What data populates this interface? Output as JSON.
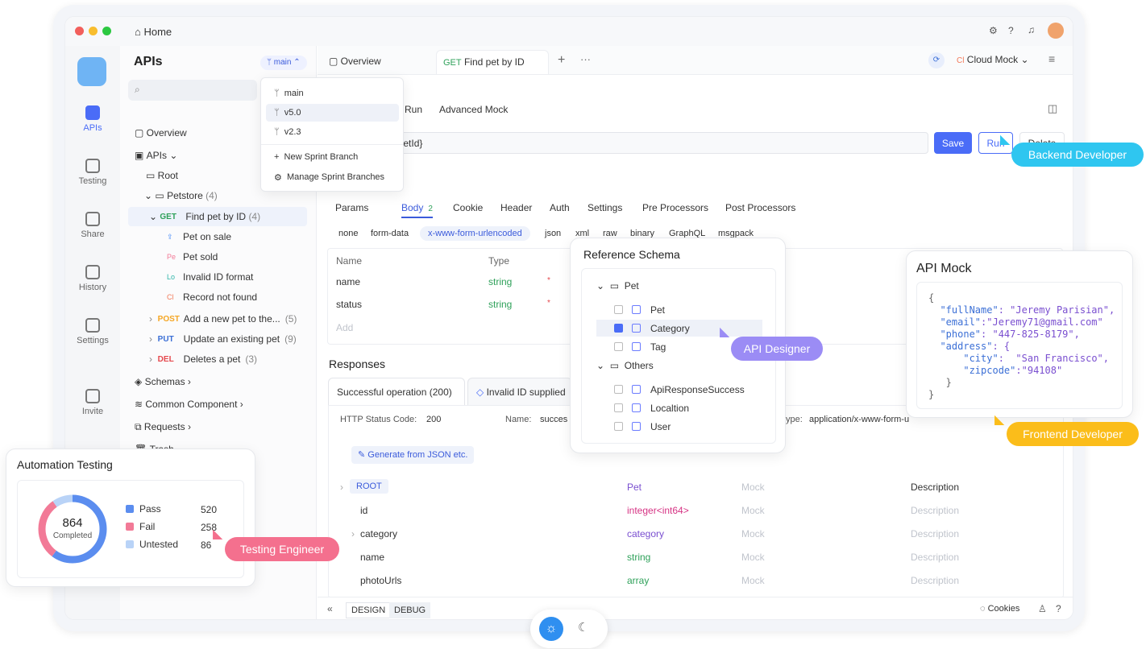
{
  "titlebar": {
    "home": "Home"
  },
  "rail": [
    {
      "label": "APIs",
      "icon": "apis-icon"
    },
    {
      "label": "Testing",
      "icon": "testing-icon"
    },
    {
      "label": "Share",
      "icon": "share-icon"
    },
    {
      "label": "History",
      "icon": "history-icon"
    },
    {
      "label": "Settings",
      "icon": "settings-icon"
    },
    {
      "label": "Invite",
      "icon": "invite-icon"
    }
  ],
  "tree": {
    "title": "APIs",
    "branch": "main",
    "overview": "Overview",
    "apis": "APIs",
    "root": "Root",
    "petstore": "Petstore",
    "petstore_count": "(4)",
    "find_pet": "Find pet by ID",
    "find_count": "(4)",
    "examples": [
      {
        "badge": "⇪",
        "label": "Pet on sale"
      },
      {
        "badge": "Pe",
        "label": "Pet sold"
      },
      {
        "badge": "Lo",
        "label": "Invalid ID format"
      },
      {
        "badge": "Cl",
        "label": "Record not found"
      }
    ],
    "endpoints": [
      {
        "method": "POST",
        "label": "Add a new pet to the...",
        "count": "(5)",
        "color": "#f5a623"
      },
      {
        "method": "PUT",
        "label": "Update an existing pet",
        "count": "(9)",
        "color": "#3b6fd6"
      },
      {
        "method": "DEL",
        "label": "Deletes a pet",
        "count": "(3)",
        "color": "#e5484d"
      }
    ],
    "get": "GET",
    "schemas": "Schemas",
    "common": "Common Component",
    "requests": "Requests",
    "trash": "Trash"
  },
  "branch_menu": {
    "items": [
      "main",
      "v5.0",
      "v2.3"
    ],
    "new": "New Sprint Branch",
    "manage": "Manage Sprint Branches"
  },
  "tabs": {
    "overview": "Overview",
    "active_method": "GET",
    "active": "Find pet by ID",
    "env": "Cloud Mock",
    "env_badge": "Cl"
  },
  "subtabs": {
    "run": "Run",
    "advanced": "Advanced Mock"
  },
  "url": "t/{petId}",
  "buttons": {
    "save": "Save",
    "run": "Run",
    "delete": "Delete"
  },
  "req_tabs": [
    "Params",
    "Body",
    "Cookie",
    "Header",
    "Auth",
    "Settings",
    "Pre Processors",
    "Post Processors"
  ],
  "body_count": "2",
  "body_types": [
    "none",
    "form-data",
    "x-www-form-urlencoded",
    "json",
    "xml",
    "raw",
    "binary",
    "GraphQL",
    "msgpack"
  ],
  "params": {
    "name_h": "Name",
    "type_h": "Type",
    "rows": [
      {
        "name": "name",
        "type": "string"
      },
      {
        "name": "status",
        "type": "string"
      }
    ],
    "add": "Add",
    "required": "*"
  },
  "responses": {
    "title": "Responses",
    "tab1": "Successful operation (200)",
    "tab2": "Invalid ID supplied",
    "status_label": "HTTP Status Code:",
    "status": "200",
    "name_label": "Name:",
    "name_val": "succes",
    "ct_label": "ype:",
    "ct_val": "application/x-www-form-u",
    "gen": "Generate from JSON etc."
  },
  "schema_rows": [
    {
      "name": "ROOT",
      "type": "Pet",
      "mock": "Mock",
      "desc": "Description"
    },
    {
      "name": "id",
      "type": "integer<int64>",
      "mock": "Mock",
      "desc": "Description"
    },
    {
      "name": "category",
      "type": "category",
      "mock": "Mock",
      "desc": "Description"
    },
    {
      "name": "name",
      "type": "string",
      "mock": "Mock",
      "desc": "Description"
    },
    {
      "name": "photoUrls",
      "type": "array",
      "mock": "Mock",
      "desc": "Description"
    }
  ],
  "ref_schema": {
    "title": "Reference Schema",
    "group1": "Pet",
    "items1": [
      "Pet",
      "Category",
      "Tag"
    ],
    "group2": "Others",
    "items2": [
      "ApiResponseSuccess",
      "Localtion",
      "User"
    ]
  },
  "mock": {
    "title": "API Mock",
    "lines": [
      [
        "{",
        "",
        ""
      ],
      [
        "  ",
        "\"fullName\"",
        ": \"Jeremy Parisian\","
      ],
      [
        "  ",
        "\"email\"",
        ":\"Jeremy71@gmail.com\""
      ],
      [
        "  ",
        "\"phone\"",
        ": \"447-825-8179\","
      ],
      [
        "  ",
        "\"address\"",
        ": {"
      ],
      [
        "      ",
        "\"city\"",
        ":  \"San Francisco\","
      ],
      [
        "      ",
        "\"zipcode\"",
        ":\"94108\""
      ],
      [
        "   }",
        "",
        ""
      ],
      [
        "}",
        "",
        ""
      ]
    ]
  },
  "automation": {
    "title": "Automation Testing",
    "total": "864",
    "total_label": "Completed",
    "pass_label": "Pass",
    "pass": 520,
    "fail_label": "Fail",
    "fail": 258,
    "untested_label": "Untested",
    "untested": 86,
    "colors": {
      "pass": "#5b8def",
      "fail": "#f27a97",
      "untested": "#b9d3f7"
    }
  },
  "roles": {
    "backend": "Backend Developer",
    "frontend": "Frontend Developer",
    "designer": "API Designer",
    "tester": "Testing Engineer"
  },
  "footer": {
    "design": "DESIGN",
    "debug": "DEBUG",
    "cookies": "Cookies"
  }
}
